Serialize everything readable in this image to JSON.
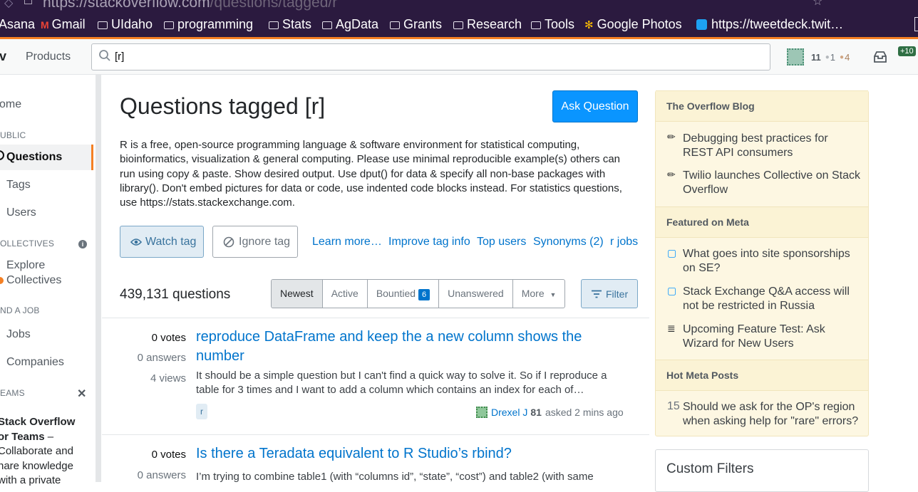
{
  "browser": {
    "url_host": "https://stackoverflow.com",
    "url_path": "/questions/tagged/r",
    "bookmarks": [
      "Asana",
      "Gmail",
      "UIdaho",
      "programming",
      "Stats",
      "AgData",
      "Grants",
      "Research",
      "Tools",
      "Google Photos",
      "https://tweetdeck.twit…"
    ]
  },
  "topbar": {
    "logo_fragment": "v",
    "products_label": "Products",
    "search_value": "[r]",
    "reputation": "11",
    "silver_badges": "1",
    "bronze_badges": "4",
    "achievements_badge": "+10"
  },
  "leftnav": {
    "home": "ome",
    "public_heading": "UBLIC",
    "questions": "Questions",
    "tags": "Tags",
    "users": "Users",
    "collectives_heading": "OLLECTIVES",
    "explore_line1": "Explore",
    "explore_line2": "Collectives",
    "find_job_heading": "ND A JOB",
    "jobs": "Jobs",
    "companies": "Companies",
    "teams_heading": "EAMS",
    "teams_title_line1": "Stack Overflow",
    "teams_title_line2": "or Teams",
    "teams_dash": " –",
    "teams_text_line1": "Collaborate and",
    "teams_text_line2": "hare knowledge",
    "teams_text_line3": "with a private"
  },
  "main": {
    "title": "Questions tagged [r]",
    "ask_button": "Ask Question",
    "description": "R is a free, open-source programming language & software environment for statistical computing, bioinformatics, visualization & general computing. Please use minimal reproducible example(s) others can run using copy & paste. Show desired output. Use dput() for data & specify all non-base packages with library(). Don't embed pictures for data or code, use indented code blocks instead. For statistics questions, use https://stats.stackexchange.com.",
    "watch_tag": "Watch tag",
    "ignore_tag": "Ignore tag",
    "links": {
      "learn_more": "Learn more…",
      "improve": "Improve tag info",
      "top_users": "Top users",
      "synonyms": "Synonyms (2)",
      "jobs": "r jobs"
    },
    "question_count": "439,131 questions",
    "filters": {
      "newest": "Newest",
      "active": "Active",
      "bountied": "Bountied",
      "bountied_count": "6",
      "unanswered": "Unanswered",
      "more": "More"
    },
    "filter_button": "Filter",
    "questions": [
      {
        "votes": "0 votes",
        "answers": "0 answers",
        "views": "4 views",
        "title": "reproduce DataFrame and keep the a new column shows the number",
        "excerpt": "It should be a simple question but I can't find a quick way to solve it. So if I reproduce a table for 3 times and I want to add a column which contains an index for each of…",
        "tag": "r",
        "user": "Drexel J",
        "rep": "81",
        "asked": "asked 2 mins ago"
      },
      {
        "votes": "0 votes",
        "answers": "0 answers",
        "title": "Is there a Teradata equivalent to R Studio’s rbind?",
        "excerpt": "I’m trying to combine table1 (with “columns id”, “state”, “cost”) and table2 (with same"
      }
    ]
  },
  "sidebar": {
    "blog_heading": "The Overflow Blog",
    "blog_items": [
      "Debugging best practices for REST API consumers",
      "Twilio launches Collective on Stack Overflow"
    ],
    "meta_heading": "Featured on Meta",
    "meta_items": [
      "What goes into site sponsorships on SE?",
      "Stack Exchange Q&A access will not be restricted in Russia",
      "Upcoming Feature Test: Ask Wizard for New Users"
    ],
    "hot_heading": "Hot Meta Posts",
    "hot_items": [
      {
        "count": "15",
        "text": "Should we ask for the OP's region when asking help for \"rare\" errors?"
      }
    ],
    "custom_filters": "Custom Filters"
  },
  "colors": {
    "accent": "#f48024",
    "link": "#0074cc",
    "primary_button": "#0a95ff",
    "sidebar_bg": "#fdf7e2"
  }
}
